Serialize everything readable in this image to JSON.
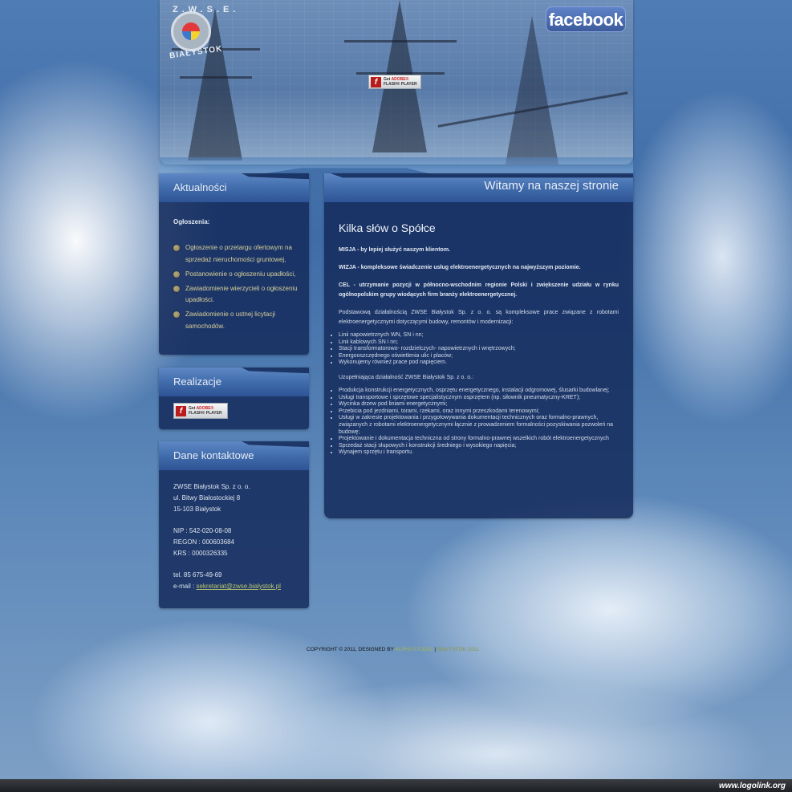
{
  "header": {
    "logo_top": "Z.W.S.E.",
    "logo_bottom": "BIAŁYSTOK",
    "facebook_label": "facebook",
    "flash_get": "Get",
    "flash_adobe": "ADOBE®",
    "flash_player": "FLASH® PLAYER"
  },
  "news": {
    "title": "Aktualności",
    "label": "Ogłoszenia:",
    "items": [
      "Ogłoszenie o przetargu ofertowym na sprzedaż nieruchomości gruntowej,",
      "Postanowienie o ogłoszeniu upadłości,",
      "Zawiadomienie wierzycieli o ogłoszeniu upadłości.",
      "Zawiadomienie o ustnej licytacji samochodów."
    ]
  },
  "realizations": {
    "title": "Realizacje"
  },
  "contact": {
    "title": "Dane kontaktowe",
    "company": "ZWSE Białystok Sp. z o. o.",
    "street": "ul. Bitwy Białostockiej 8",
    "city": "15-103 Białystok",
    "nip": "NIP : 542-020-08-08",
    "regon": "REGON : 000603684",
    "krs": "KRS : 0000326335",
    "phone": "tel. 85 675-49-69",
    "email_label": "e-mail :",
    "email": "sekretariat@zwse.bialystok.pl"
  },
  "main": {
    "title": "Witamy na naszej stronie",
    "heading": "Kilka słów o Spółce",
    "misja": "MISJA - by lepiej służyć naszym klientom.",
    "wizja": "WIZJA - kompleksowe świadczenie usług elektroenergetycznych na najwyższym poziomie.",
    "cel": "CEL - utrzymanie pozycji w północno-wschodnim regionie Polski i zwiększenie udziału w rynku ogólnopolskim grupy wiodących firm branży elektroenergetycznej.",
    "intro": "Podstawową działalnością ZWSE Białystok Sp. z o. o. są kompleksowe prace związane z robotami elektroenergetycznymi dotyczącymi budowy, remontów i modernizacji:",
    "list1": [
      "Linii napowietrznych WN, SN i nn;",
      "Linii kablowych SN i nn;",
      "Stacji transformatorowo- rozdzielczych- napowietrznych i wnętrzowych;",
      "Energooszczędnego oświetlenia ulic i placów;",
      "Wykonujemy również prace pod napięciem."
    ],
    "supplement": "Uzupełniająca działalność ZWSE Białystok Sp. z o. o.:",
    "list2": [
      "Produkcja konstrukcji energetycznych, osprzętu energetycznego, instalacji odgromowej, ślusarki budowlanej;",
      "Usługi transportowe i sprzętowe specjalistycznym osprzętem (np. siłownik pneumatyczny-KRET);",
      "Wycinka drzew pod liniami energetycznymi;",
      "Przebicia pod jezdniami, torami, rzekami, oraz innymi przeszkodami terenowymi;",
      "Usługi w zakresie projektowania i przygotowywania dokumentacji technicznych oraz formalno-prawnych, związanych z robotami elektroenergetycznymi łącznie z prowadzeniem formalności pozyskiwania pozwoleń na budowę;",
      "Projektowanie i dokumentacja techniczna od strony formalno-prawnej wszelkich robót elektroenergetycznych",
      "Sprzedaż stacji słupowych i konstrukcji średniego i wysokiego napięcia;",
      "Wynajem sprzętu i transportu."
    ]
  },
  "footer": {
    "text": "COPYRIGHT © 2011, DESIGNED BY",
    "link": "ALPHA STUDIO",
    "separator": "|",
    "link2": "BIAŁYSTOK 2011"
  },
  "watermark": "www.logolink.org",
  "colors": {
    "panel": "#142a5c",
    "panel_header": "#3f6aaa",
    "news_link": "#d8cf9a",
    "footer_link": "#a7b44d"
  }
}
